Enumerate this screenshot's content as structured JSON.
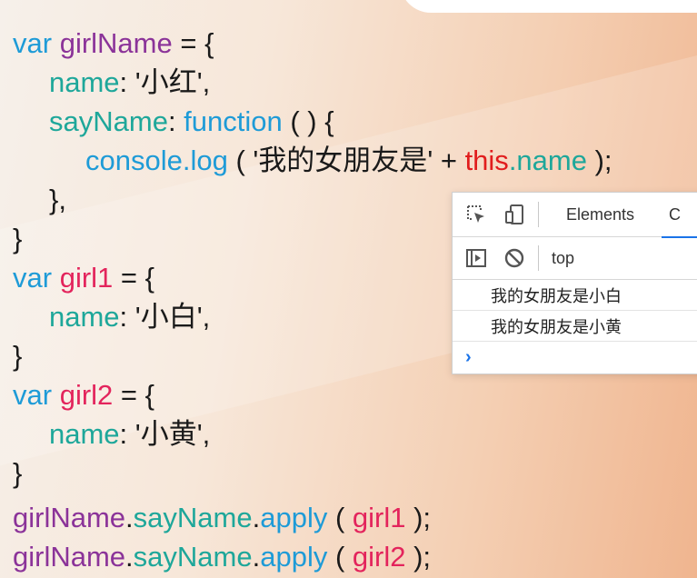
{
  "code": {
    "l1_var": "var",
    "l1_name": "girlName",
    "l1_rest": " = {",
    "l2_key": "name",
    "l2_sep": ": '",
    "l2_val": "小红",
    "l2_end": "',",
    "l3_key": "sayName",
    "l3_sep": ": ",
    "l3_fn": "function",
    "l3_end": " ( ) {",
    "l4_console": "console.log",
    "l4_open": " ( '",
    "l4_str": "我的女朋友是",
    "l4_plus": "' + ",
    "l4_this": "this",
    "l4_dotname": ".name",
    "l4_end": " );",
    "l5": "},",
    "l6": "}",
    "l7_var": "var",
    "l7_name": "girl1",
    "l7_rest": " = {",
    "l8_key": "name",
    "l8_sep": ": '",
    "l8_val": "小白",
    "l8_end": "',",
    "l9": "}",
    "l10_var": "var",
    "l10_name": "girl2",
    "l10_rest": " = {",
    "l11_key": "name",
    "l11_sep": ": '",
    "l11_val": "小黄",
    "l11_end": "',",
    "l12": "}",
    "l13_obj": "girlName",
    "l13_dot1": ".",
    "l13_method": "sayName",
    "l13_dot2": ".",
    "l13_apply": "apply",
    "l13_open": " ( ",
    "l13_arg": "girl1",
    "l13_end": " );",
    "l14_obj": "girlName",
    "l14_dot1": ".",
    "l14_method": "sayName",
    "l14_dot2": ".",
    "l14_apply": "apply",
    "l14_open": " ( ",
    "l14_arg": "girl2",
    "l14_end": " );"
  },
  "devtools": {
    "inspect_icon": "inspect-element-icon",
    "device_icon": "device-toggle-icon",
    "tab_elements": "Elements",
    "tab_console": "C",
    "sidebar_icon": "console-sidebar-icon",
    "clear_icon": "clear-console-icon",
    "context": "top",
    "messages": [
      "我的女朋友是小白",
      "我的女朋友是小黄"
    ],
    "prompt": "›",
    "accent_color": "#1a73e8"
  }
}
